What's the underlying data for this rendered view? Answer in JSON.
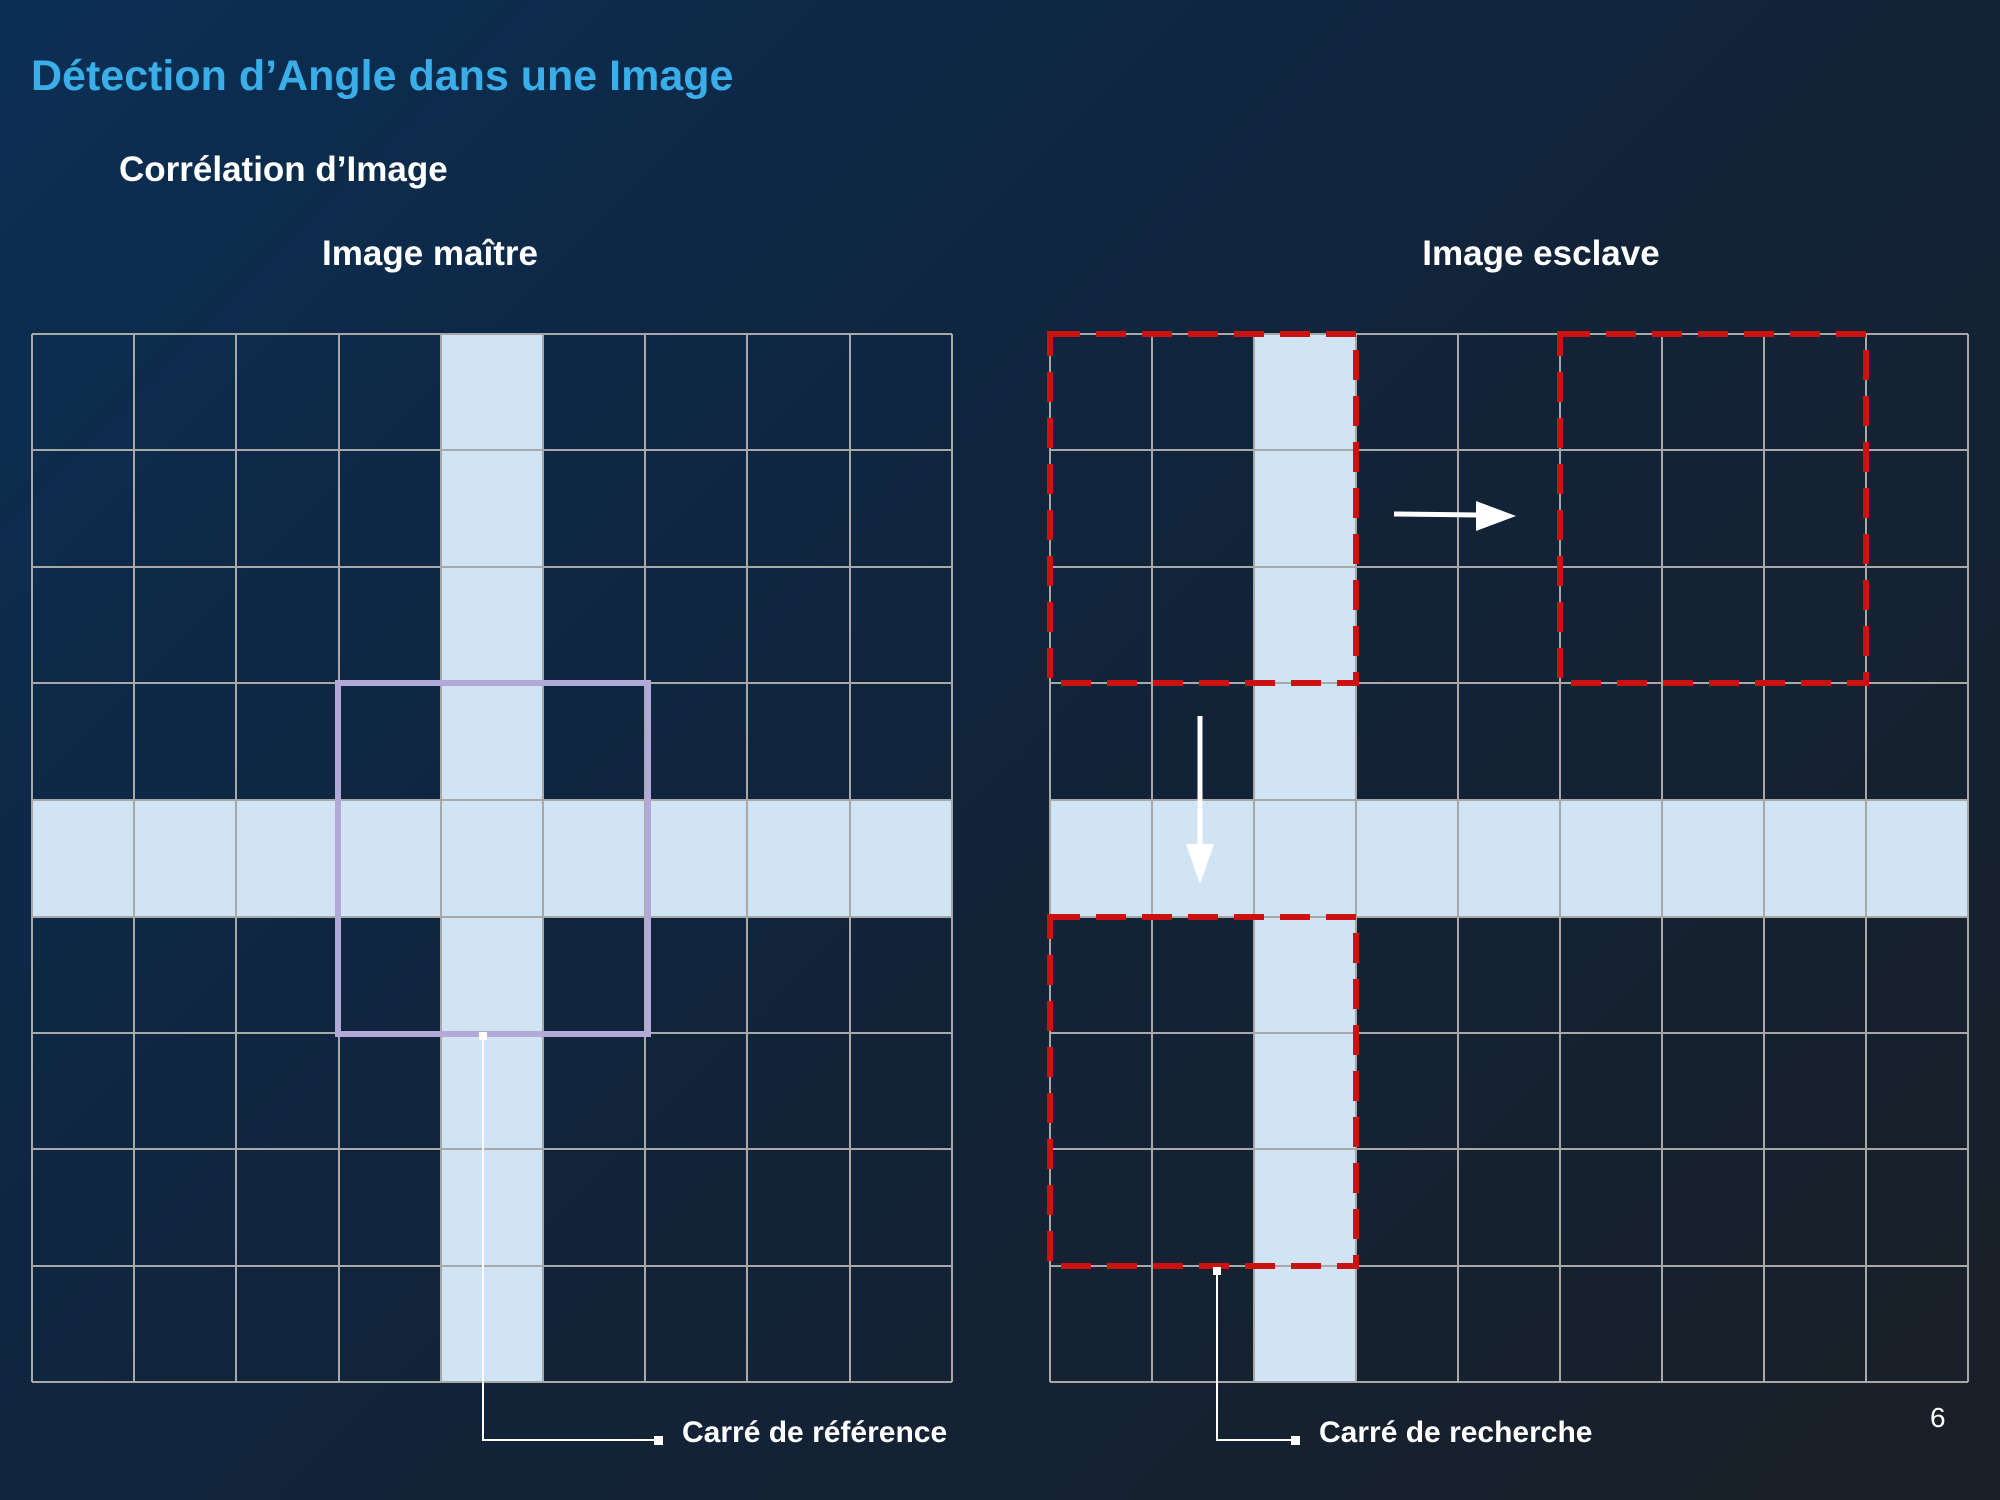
{
  "slide": {
    "title": "Détection d’Angle dans une Image",
    "subtitle": "Corrélation d’Image",
    "page_number": "6"
  },
  "panels": {
    "master": {
      "title": "Image maître"
    },
    "slave": {
      "title": "Image esclave"
    }
  },
  "callouts": {
    "reference": "Carré de référence",
    "search": "Carré de recherche"
  },
  "colors": {
    "title": "#3aaee8",
    "cross_fill": "#d1e4f3",
    "grid_line": "#a8a8a8",
    "reference_square": "#b3a9d8",
    "search_square": "#cc1111",
    "arrow": "#ffffff"
  }
}
